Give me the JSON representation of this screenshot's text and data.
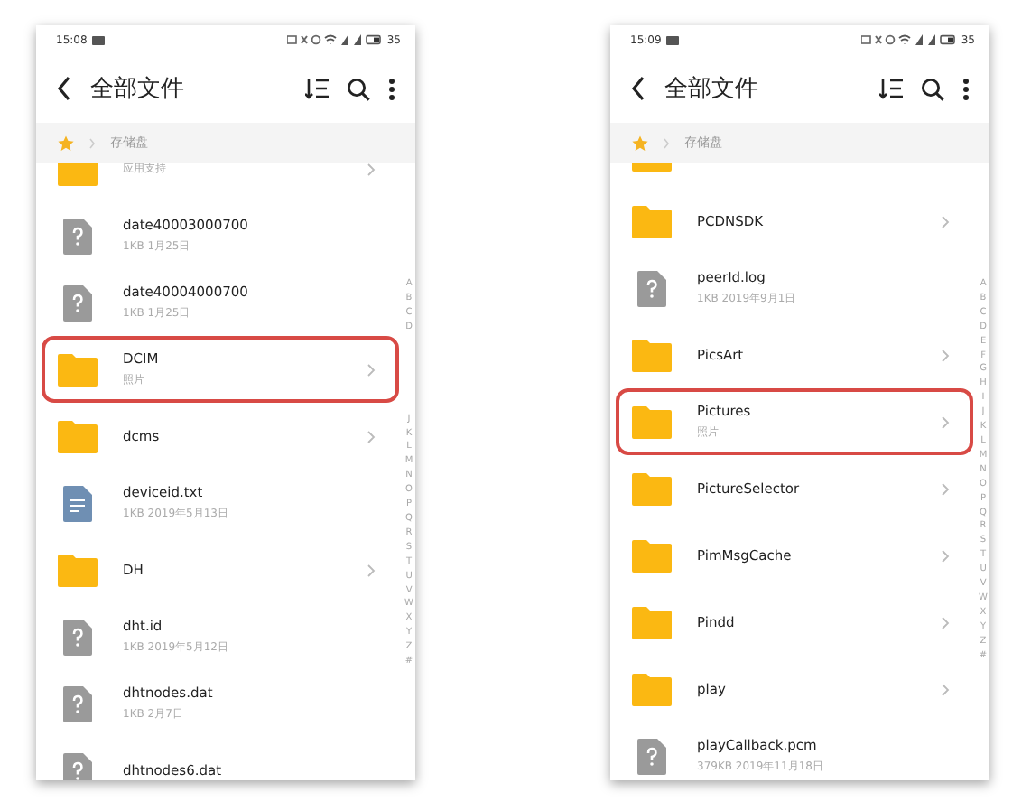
{
  "phones": [
    {
      "status": {
        "time": "15:08",
        "battery": "35"
      },
      "title": "全部文件",
      "breadcrumb": "存储盘",
      "index_groups": [
        [
          "A",
          "B",
          "C",
          "D"
        ],
        [
          "J",
          "K",
          "L",
          "M",
          "N",
          "O",
          "P",
          "Q",
          "R",
          "S",
          "T",
          "U",
          "V",
          "W",
          "X",
          "Y",
          "Z",
          "#"
        ]
      ],
      "rows": [
        {
          "kind": "folder_cut",
          "meta": "应用支持",
          "chevron": true,
          "highlighted": false
        },
        {
          "kind": "unknown",
          "name": "date40003000700",
          "meta": "1KB  1月25日",
          "chevron": false,
          "highlighted": false
        },
        {
          "kind": "unknown",
          "name": "date40004000700",
          "meta": "1KB  1月25日",
          "chevron": false,
          "highlighted": false
        },
        {
          "kind": "folder",
          "name": "DCIM",
          "meta": "照片",
          "chevron": true,
          "highlighted": true
        },
        {
          "kind": "folder",
          "name": "dcms",
          "chevron": true,
          "highlighted": false
        },
        {
          "kind": "text",
          "name": "deviceid.txt",
          "meta": "1KB  2019年5月13日",
          "chevron": false,
          "highlighted": false
        },
        {
          "kind": "folder",
          "name": "DH",
          "chevron": true,
          "highlighted": false
        },
        {
          "kind": "unknown",
          "name": "dht.id",
          "meta": "1KB  2019年5月12日",
          "chevron": false,
          "highlighted": false
        },
        {
          "kind": "unknown",
          "name": "dhtnodes.dat",
          "meta": "1KB  2月7日",
          "chevron": false,
          "highlighted": false
        },
        {
          "kind": "unknown",
          "name": "dhtnodes6.dat",
          "chevron": false,
          "highlighted": false
        }
      ]
    },
    {
      "status": {
        "time": "15:09",
        "battery": "35"
      },
      "title": "全部文件",
      "breadcrumb": "存储盘",
      "index_groups": [
        [
          "A",
          "B",
          "C",
          "D",
          "E",
          "F",
          "G",
          "H",
          "I",
          "J",
          "K",
          "L",
          "M",
          "N",
          "O",
          "P",
          "Q",
          "R",
          "S",
          "T",
          "U",
          "V",
          "W",
          "X",
          "Y",
          "Z",
          "#"
        ]
      ],
      "rows": [
        {
          "kind": "folder_peek",
          "chevron": false,
          "highlighted": false
        },
        {
          "kind": "folder",
          "name": "PCDNSDK",
          "chevron": true,
          "highlighted": false
        },
        {
          "kind": "unknown",
          "name": "peerId.log",
          "meta": "1KB  2019年9月1日",
          "chevron": false,
          "highlighted": false
        },
        {
          "kind": "folder",
          "name": "PicsArt",
          "chevron": true,
          "highlighted": false
        },
        {
          "kind": "folder",
          "name": "Pictures",
          "meta": "照片",
          "chevron": true,
          "highlighted": true
        },
        {
          "kind": "folder",
          "name": "PictureSelector",
          "chevron": true,
          "highlighted": false
        },
        {
          "kind": "folder",
          "name": "PimMsgCache",
          "chevron": true,
          "highlighted": false
        },
        {
          "kind": "folder",
          "name": "Pindd",
          "chevron": true,
          "highlighted": false
        },
        {
          "kind": "folder",
          "name": "play",
          "chevron": true,
          "highlighted": false
        },
        {
          "kind": "unknown",
          "name": "playCallback.pcm",
          "meta": "379KB  2019年11月18日",
          "chevron": false,
          "highlighted": false
        }
      ]
    }
  ]
}
